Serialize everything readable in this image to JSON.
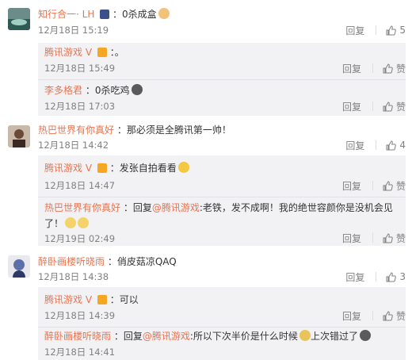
{
  "c1": {
    "name": "知行合一· LH",
    "text": "0杀成盒",
    "time": "12月18日 15:19",
    "reply_label": "回复",
    "like_count": "5",
    "replies": [
      {
        "name": "腾讯游戏",
        "text": "。",
        "time": "12月18日 15:49",
        "reply_label": "回复",
        "like_label": "赞"
      },
      {
        "name": "李多格君",
        "text": "0杀吃鸡",
        "time": "12月18日 17:03",
        "reply_label": "回复",
        "like_label": "赞"
      }
    ]
  },
  "c2": {
    "name": "热巴世界有你真好",
    "text": "那必须是全腾讯第一帅！",
    "time": "12月18日 14:42",
    "reply_label": "回复",
    "like_count": "4",
    "replies": [
      {
        "name": "腾讯游戏",
        "text": "发张自拍看看",
        "time": "12月18日 14:47",
        "reply_label": "回复",
        "like_label": "赞"
      },
      {
        "name": "热巴世界有你真好",
        "reply_prefix": "回复",
        "mention": "@腾讯游戏",
        "text_line1": ":老铁，发不成啊！我的绝世容颜你是没机会见",
        "text_line2": "了！",
        "time": "12月19日 02:49",
        "reply_label": "回复",
        "like_label": "赞"
      }
    ]
  },
  "c3": {
    "name": "醉卧画楼听晓雨",
    "text": "俏皮菇凉QAQ",
    "time": "12月18日 14:38",
    "reply_label": "回复",
    "like_count": "3",
    "replies": [
      {
        "name": "腾讯游戏",
        "text": "可以",
        "time": "12月18日 14:39",
        "reply_label": "回复",
        "like_label": "赞"
      },
      {
        "name": "醉卧画楼听晓雨",
        "reply_prefix": "回复",
        "mention": "@腾讯游戏",
        "text_a": ":所以下次半价是什么时候",
        "text_b": "上次错过了",
        "time": "12月18日 14:41",
        "reply_label": "回复",
        "like_label": "赞"
      }
    ]
  },
  "colon": "："
}
